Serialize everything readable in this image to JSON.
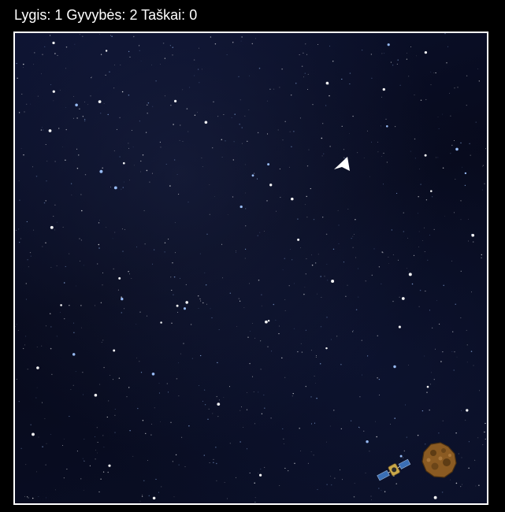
{
  "hud": {
    "level_label": "Lygis:",
    "level_value": "1",
    "lives_label": "Gyvybės:",
    "lives_value": "2",
    "score_label": "Taškai:",
    "score_value": "0"
  },
  "colors": {
    "hud_text": "#ffffff",
    "frame_border": "#ffffff",
    "space_background": "#080c22",
    "ship": "#ffffff",
    "asteroid": "#8a5a22",
    "satellite_panels": "#3b6fb5",
    "satellite_body": "#c9a84a"
  },
  "sprites": {
    "ship_icon": "player-ship-icon",
    "satellite_icon": "satellite-icon",
    "asteroid_icon": "asteroid-icon"
  }
}
